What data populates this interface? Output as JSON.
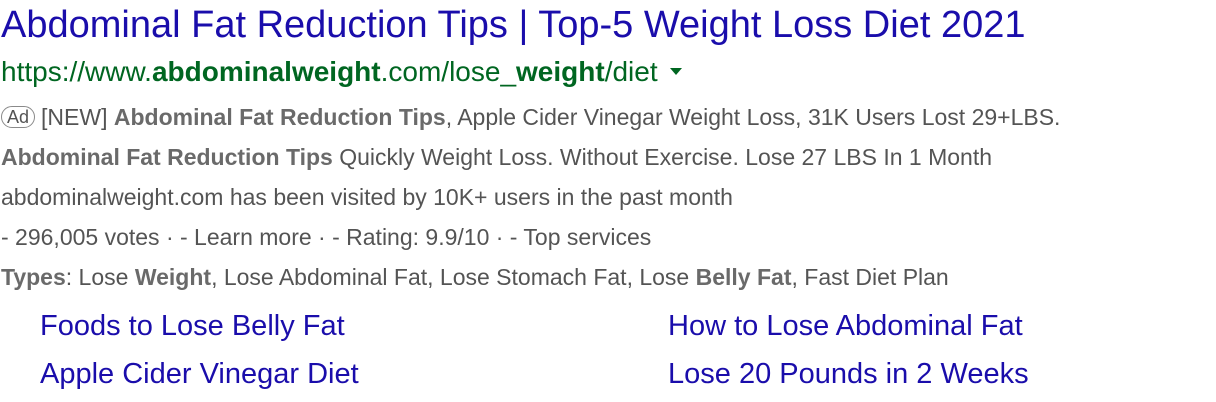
{
  "ad": {
    "title": "Abdominal Fat Reduction Tips | Top-5 Weight Loss Diet 2021",
    "url": {
      "prefix": "https://www.",
      "domain_bold": "abdominalweight",
      "mid": ".com/lose_",
      "path_bold": "weight",
      "suffix": "/diet"
    },
    "badge": "Ad",
    "line1": {
      "prefix": "[NEW] ",
      "bold": "Abdominal Fat Reduction Tips",
      "rest": ", Apple Cider Vinegar Weight Loss, 31K Users Lost 29+LBS."
    },
    "line2": {
      "bold": "Abdominal Fat Reduction Tips",
      "rest": " Quickly Weight Loss. Without Exercise. Lose 27 LBS In 1 Month"
    },
    "line3": "abdominalweight.com has been visited by 10K+ users in the past month",
    "line4": "- 296,005 votes · - Learn more · - Rating: 9.9/10 · - Top services",
    "line5": {
      "label": "Types",
      "p1": ": Lose ",
      "b1": "Weight",
      "p2": ", Lose Abdominal Fat, Lose Stomach Fat, Lose ",
      "b2": "Belly Fat",
      "p3": ", Fast Diet Plan"
    },
    "sitelinks": [
      "Foods to Lose Belly Fat",
      "How to Lose Abdominal Fat",
      "Apple Cider Vinegar Diet",
      "Lose 20 Pounds in 2 Weeks"
    ]
  },
  "colors": {
    "link": "#1a0dab",
    "url": "#006621",
    "text": "#545454"
  }
}
